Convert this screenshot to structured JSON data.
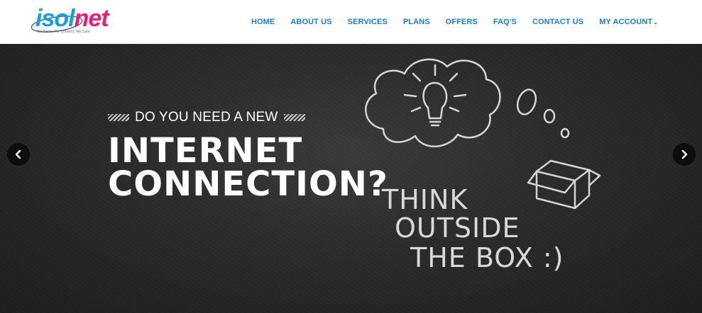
{
  "logo": {
    "part1": "isol",
    "part2": "net",
    "tagline": "We Serve, We Connect, We Care"
  },
  "nav": {
    "items": [
      "HOME",
      "ABOUT US",
      "SERVICES",
      "PLANS",
      "OFFERS",
      "FAQ'S",
      "CONTACT US",
      "MY ACCOUNT"
    ]
  },
  "hero": {
    "subline": "DO YOU NEED A NEW",
    "headline_line1": "INTERNET",
    "headline_line2": "CONNECTION?",
    "chalk_line1": "THINK",
    "chalk_line2": "OUTSIDE",
    "chalk_line3": "THE BOX :)"
  },
  "icons": {
    "prev": "chevron-left-icon",
    "next": "chevron-right-icon",
    "caret": "chevron-down-icon"
  },
  "colors": {
    "nav": "#1b7fc1",
    "logo_blue": "#1a9ed9",
    "logo_pink": "#e4227a",
    "hero_bg": "#2b2b2b"
  }
}
